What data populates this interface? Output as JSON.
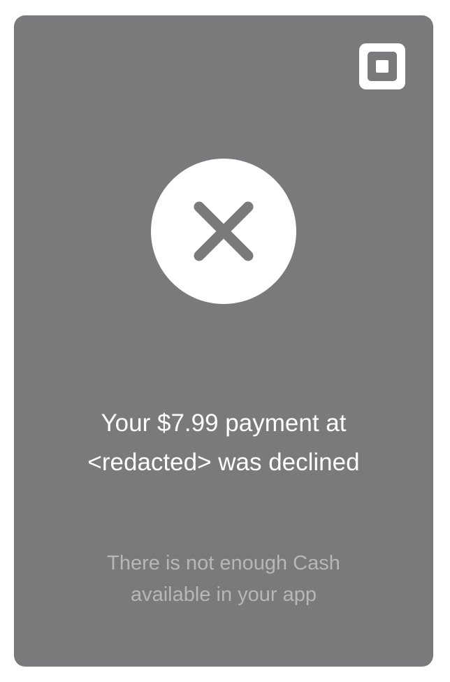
{
  "notification": {
    "brand_icon": "square-logo-icon",
    "status_icon": "close-icon",
    "title": "Your $7.99 payment at <redacted> was declined",
    "detail": "There is not enough Cash available in your app"
  },
  "colors": {
    "card_background": "#7a797b",
    "title_text": "#ffffff",
    "detail_text": "#b7b6b8",
    "icon_background": "#ffffff"
  }
}
